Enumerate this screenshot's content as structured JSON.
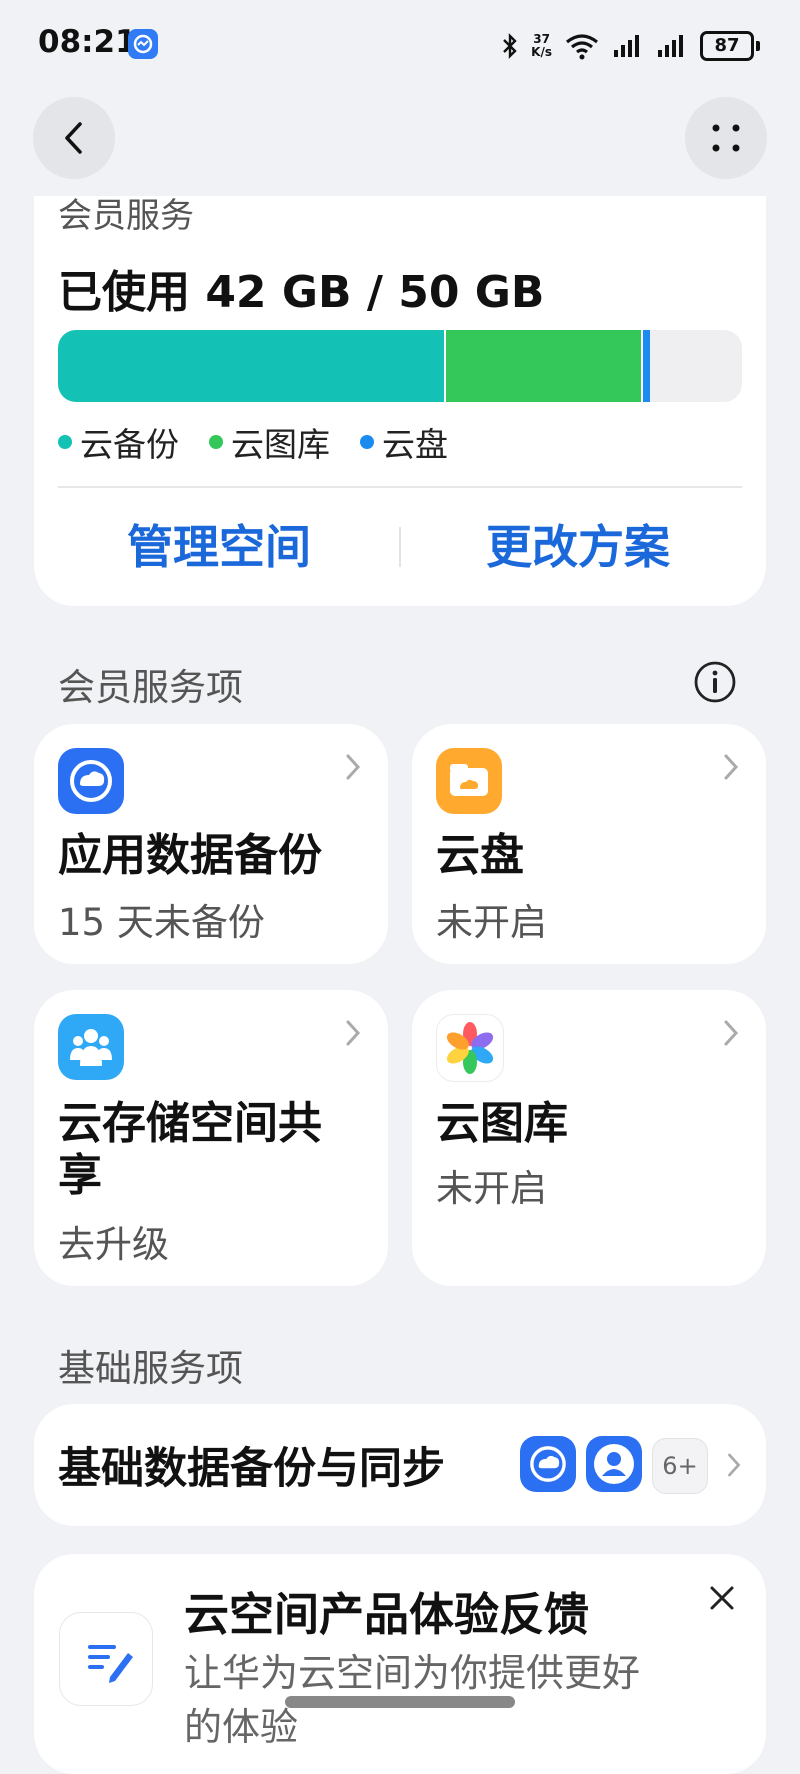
{
  "status_bar": {
    "time": "08:21",
    "net_speed_value": "37",
    "net_speed_unit": "K/s",
    "battery": "87"
  },
  "nav": {
    "back_icon": "chevron-left-icon",
    "more_icon": "grid-dots-icon"
  },
  "storage": {
    "cut_title": "会员服务",
    "usage_text": "已使用 42 GB / 50 GB",
    "used_gb": 42,
    "total_gb": 50,
    "breakdown": [
      {
        "name": "云备份",
        "color": "#13c2b4",
        "percent": 56.5
      },
      {
        "name": "云图库",
        "color": "#34c759",
        "percent": 28.8
      },
      {
        "name": "云盘",
        "color": "#1a8cf0",
        "percent": 1.0
      }
    ],
    "manage_label": "管理空间",
    "change_plan_label": "更改方案"
  },
  "member_section": {
    "title": "会员服务项",
    "info_icon": "info-icon",
    "tiles": [
      {
        "name": "应用数据备份",
        "sub": "15 天未备份",
        "icon": "app-backup-icon",
        "color": "#2b6ff3"
      },
      {
        "name": "云盘",
        "sub": "未开启",
        "icon": "cloud-drive-icon",
        "color": "#ffa92e"
      },
      {
        "name": "云存储空间共享",
        "sub": "去升级",
        "icon": "family-share-icon",
        "color": "#2fa8f5"
      },
      {
        "name": "云图库",
        "sub": "未开启",
        "icon": "gallery-icon",
        "color": "#ffffff"
      }
    ]
  },
  "basic_section": {
    "title": "基础服务项",
    "row_label": "基础数据备份与同步",
    "more_count": "6+"
  },
  "feedback": {
    "title": "云空间产品体验反馈",
    "desc": "让华为云空间为你提供更好的体验"
  }
}
